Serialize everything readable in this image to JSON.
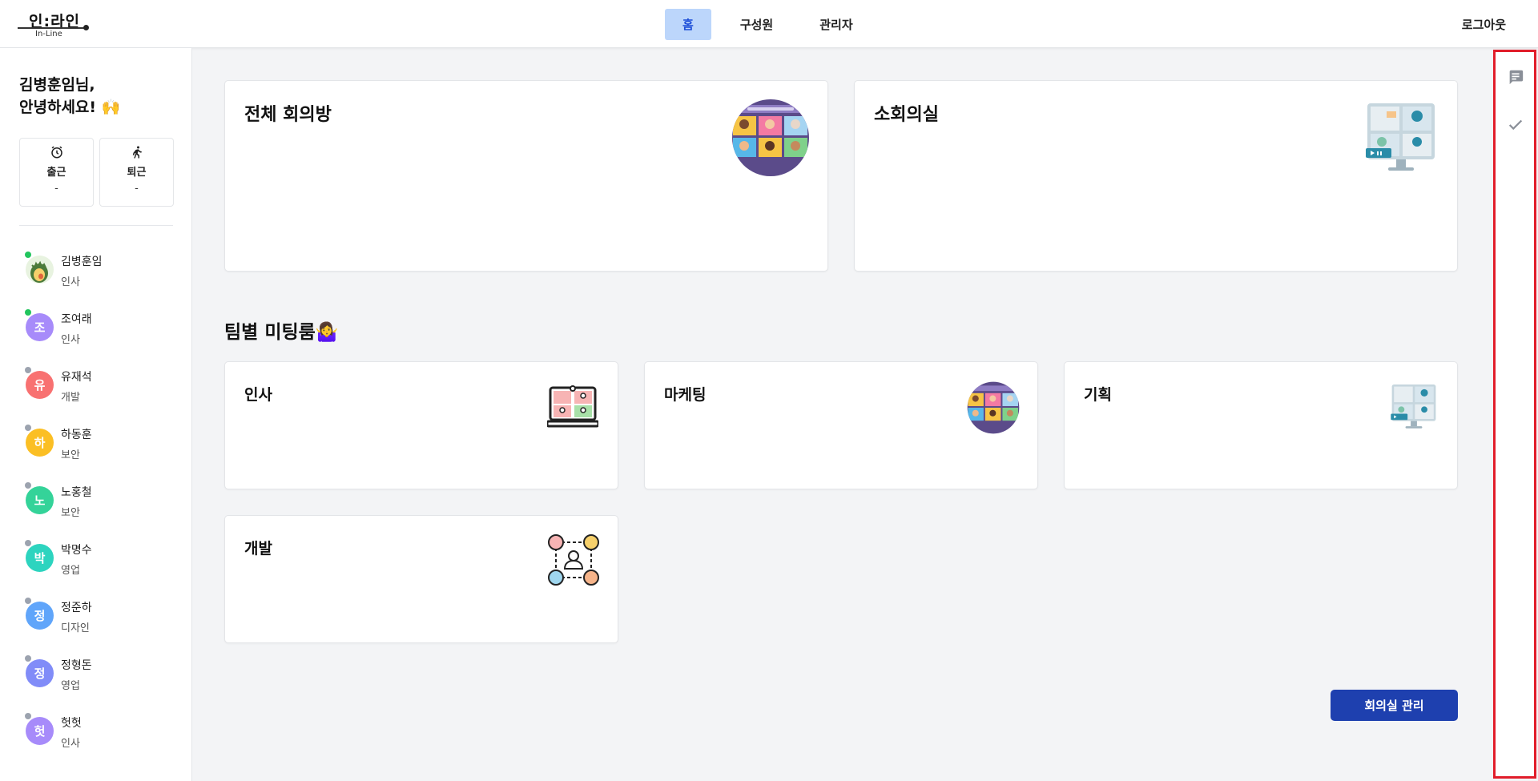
{
  "app": {
    "logo_text": "인:라인",
    "logo_sub": "In-Line"
  },
  "nav": {
    "items": [
      {
        "label": "홈",
        "active": true
      },
      {
        "label": "구성원",
        "active": false
      },
      {
        "label": "관리자",
        "active": false
      }
    ],
    "logout": "로그아웃"
  },
  "sidebar": {
    "greeting_line1": "김병훈임님,",
    "greeting_line2": "안녕하세요! 🙌",
    "clock_in": {
      "label": "출근",
      "value": "-"
    },
    "clock_out": {
      "label": "퇴근",
      "value": "-"
    },
    "members": [
      {
        "name": "김병훈임",
        "dept": "인사",
        "initial": "",
        "online": true,
        "color": "#4b7a3a"
      },
      {
        "name": "조여래",
        "dept": "인사",
        "initial": "조",
        "online": true,
        "color": "#a78bfa"
      },
      {
        "name": "유재석",
        "dept": "개발",
        "initial": "유",
        "online": false,
        "color": "#f87171"
      },
      {
        "name": "하동훈",
        "dept": "보안",
        "initial": "하",
        "online": false,
        "color": "#fbbf24"
      },
      {
        "name": "노홍철",
        "dept": "보안",
        "initial": "노",
        "online": false,
        "color": "#34d399"
      },
      {
        "name": "박명수",
        "dept": "영업",
        "initial": "박",
        "online": false,
        "color": "#2dd4bf"
      },
      {
        "name": "정준하",
        "dept": "디자인",
        "initial": "정",
        "online": false,
        "color": "#60a5fa"
      },
      {
        "name": "정형돈",
        "dept": "영업",
        "initial": "정",
        "online": false,
        "color": "#818cf8"
      },
      {
        "name": "헛헛",
        "dept": "인사",
        "initial": "헛",
        "online": false,
        "color": "#a78bfa"
      }
    ]
  },
  "main": {
    "rooms": [
      {
        "title": "전체 회의방"
      },
      {
        "title": "소회의실"
      }
    ],
    "team_section_title": "팀별 미팅룸🤷‍♀️",
    "teams": [
      {
        "title": "인사"
      },
      {
        "title": "마케팅"
      },
      {
        "title": "기획"
      },
      {
        "title": "개발"
      }
    ],
    "manage_button": "회의실 관리"
  },
  "colors": {
    "accent": "#1e40af",
    "nav_active_bg": "#bcd6fb",
    "online": "#22c55e",
    "offline": "#9ca3af",
    "rail_border": "#e11d2a"
  }
}
